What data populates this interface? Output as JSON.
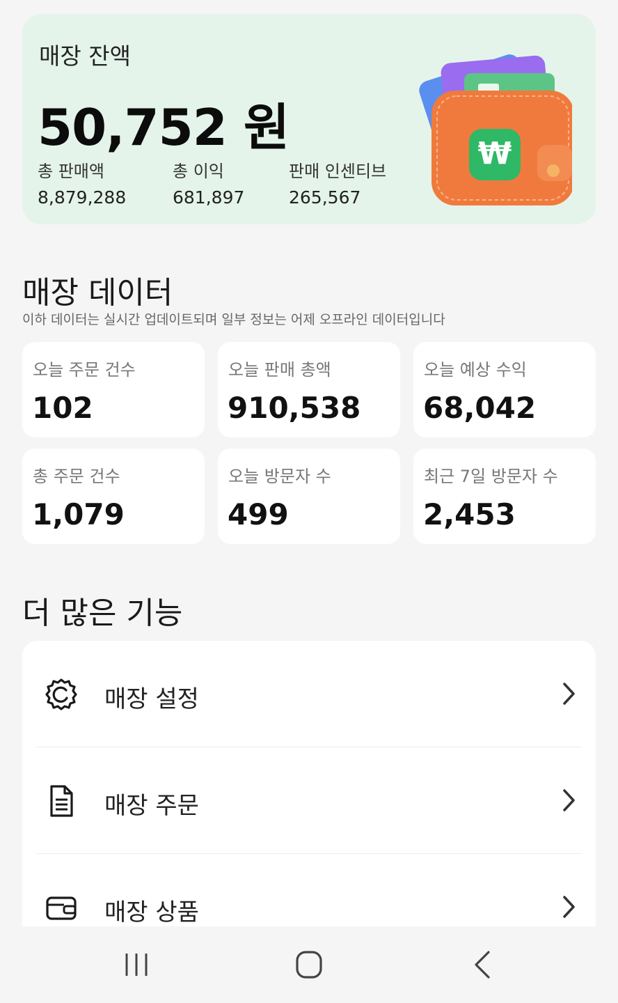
{
  "balance": {
    "title": "매장 잔액",
    "amount": "50,752 원",
    "stats": [
      {
        "label": "총 판매액",
        "value": "8,879,288"
      },
      {
        "label": "총 이익",
        "value": "681,897"
      },
      {
        "label": "판매 인센티브",
        "value": "265,567"
      }
    ],
    "wallet_symbol": "₩",
    "colors": {
      "card_bg": "#e4f4ea",
      "wallet_orange": "#f07a3e",
      "wallet_badge": "#2fb866"
    }
  },
  "store_data": {
    "title": "매장 데이터",
    "subtitle": "이하 데이터는 실시간 업데이트되며 일부 정보는 어제 오프라인 데이터입니다",
    "metrics": [
      {
        "label": "오늘 주문 건수",
        "value": "102"
      },
      {
        "label": "오늘 판매 총액",
        "value": "910,538"
      },
      {
        "label": "오늘 예상 수익",
        "value": "68,042"
      },
      {
        "label": "총 주문 건수",
        "value": "1,079"
      },
      {
        "label": "오늘 방문자 수",
        "value": "499"
      },
      {
        "label": "최근 7일 방문자 수",
        "value": "2,453"
      }
    ]
  },
  "more_features": {
    "title": "더 많은 기능",
    "items": [
      {
        "label": "매장 설정",
        "icon": "gear-icon"
      },
      {
        "label": "매장 주문",
        "icon": "document-icon"
      },
      {
        "label": "매장 상품",
        "icon": "wallet-icon"
      }
    ]
  },
  "navigation": {
    "buttons": [
      "recent-apps-icon",
      "home-icon",
      "back-icon"
    ]
  }
}
